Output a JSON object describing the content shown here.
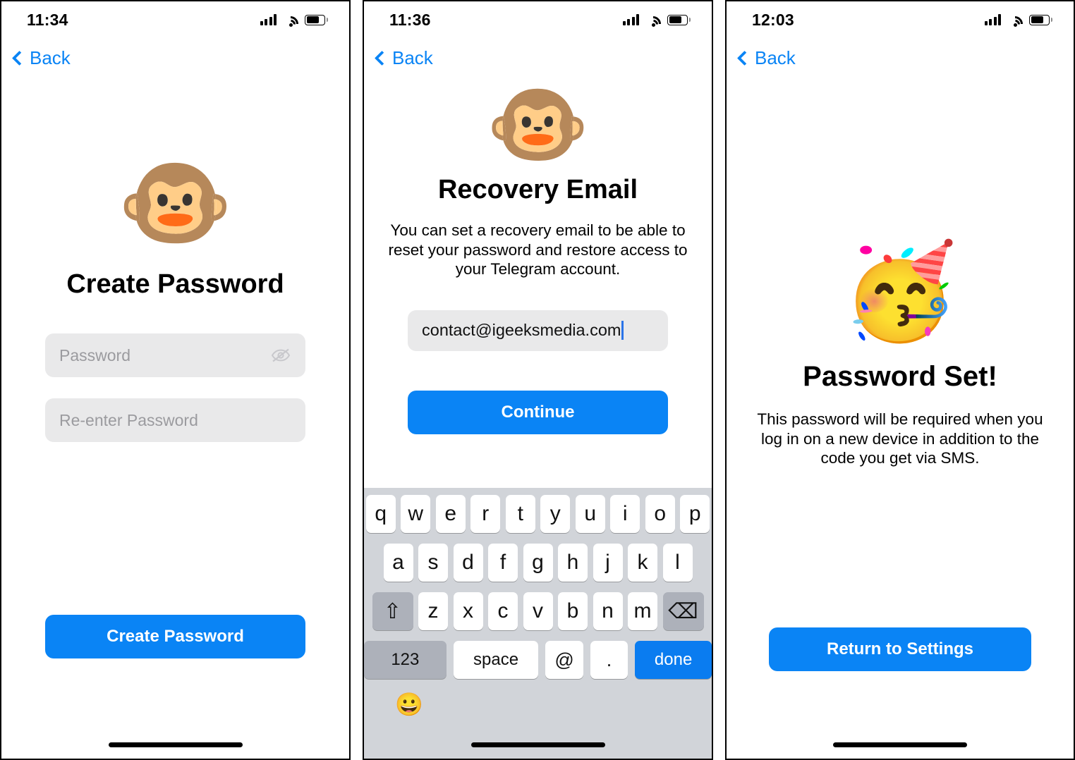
{
  "screens": [
    {
      "status": {
        "time": "11:34",
        "signal_icon": "cellular-signal-icon",
        "wifi_icon": "wifi-icon",
        "battery_icon": "battery-icon"
      },
      "nav": {
        "back_label": "Back",
        "back_icon": "chevron-left-icon"
      },
      "emoji": "🐵",
      "emoji_name": "monkey-face-emoji",
      "title": "Create Password",
      "fields": [
        {
          "placeholder": "Password",
          "value": "",
          "trailing_icon": "eye-off-icon"
        },
        {
          "placeholder": "Re-enter Password",
          "value": "",
          "trailing_icon": ""
        }
      ],
      "primary_button": "Create Password"
    },
    {
      "status": {
        "time": "11:36",
        "signal_icon": "cellular-signal-icon",
        "wifi_icon": "wifi-icon",
        "battery_icon": "battery-icon"
      },
      "nav": {
        "back_label": "Back",
        "back_icon": "chevron-left-icon"
      },
      "emoji": "🐵",
      "emoji_name": "monkey-face-emoji",
      "title": "Recovery Email",
      "description": "You can set a recovery email to be able to reset your password and restore access to your Telegram account.",
      "email_field": {
        "value": "contact@igeeksmedia.com",
        "placeholder": ""
      },
      "primary_button": "Continue",
      "keyboard": {
        "row1": [
          "q",
          "w",
          "e",
          "r",
          "t",
          "y",
          "u",
          "i",
          "o",
          "p"
        ],
        "row2": [
          "a",
          "s",
          "d",
          "f",
          "g",
          "h",
          "j",
          "k",
          "l"
        ],
        "row3": [
          "z",
          "x",
          "c",
          "v",
          "b",
          "n",
          "m"
        ],
        "shift_key": "⇧",
        "backspace_key": "⌫",
        "numbers_key": "123",
        "space_key": "space",
        "at_key": "@",
        "dot_key": ".",
        "done_key": "done",
        "emoji_key": "😀"
      }
    },
    {
      "status": {
        "time": "12:03",
        "signal_icon": "cellular-signal-icon",
        "wifi_icon": "wifi-icon",
        "battery_icon": "battery-icon"
      },
      "nav": {
        "back_label": "Back",
        "back_icon": "chevron-left-icon"
      },
      "emoji": "🥳",
      "emoji_name": "partying-face-emoji",
      "title": "Password Set!",
      "description": "This password will be required when you log in on a new device in addition to the code you get via SMS.",
      "primary_button": "Return to Settings"
    }
  ],
  "colors": {
    "accent_blue": "#0a84f5",
    "field_gray": "#e9e9ea",
    "keyboard_bg": "#d1d4d9",
    "key_fn_gray": "#adb1ba",
    "done_blue": "#0a7cf0",
    "placeholder_gray": "#9b9b9f"
  }
}
